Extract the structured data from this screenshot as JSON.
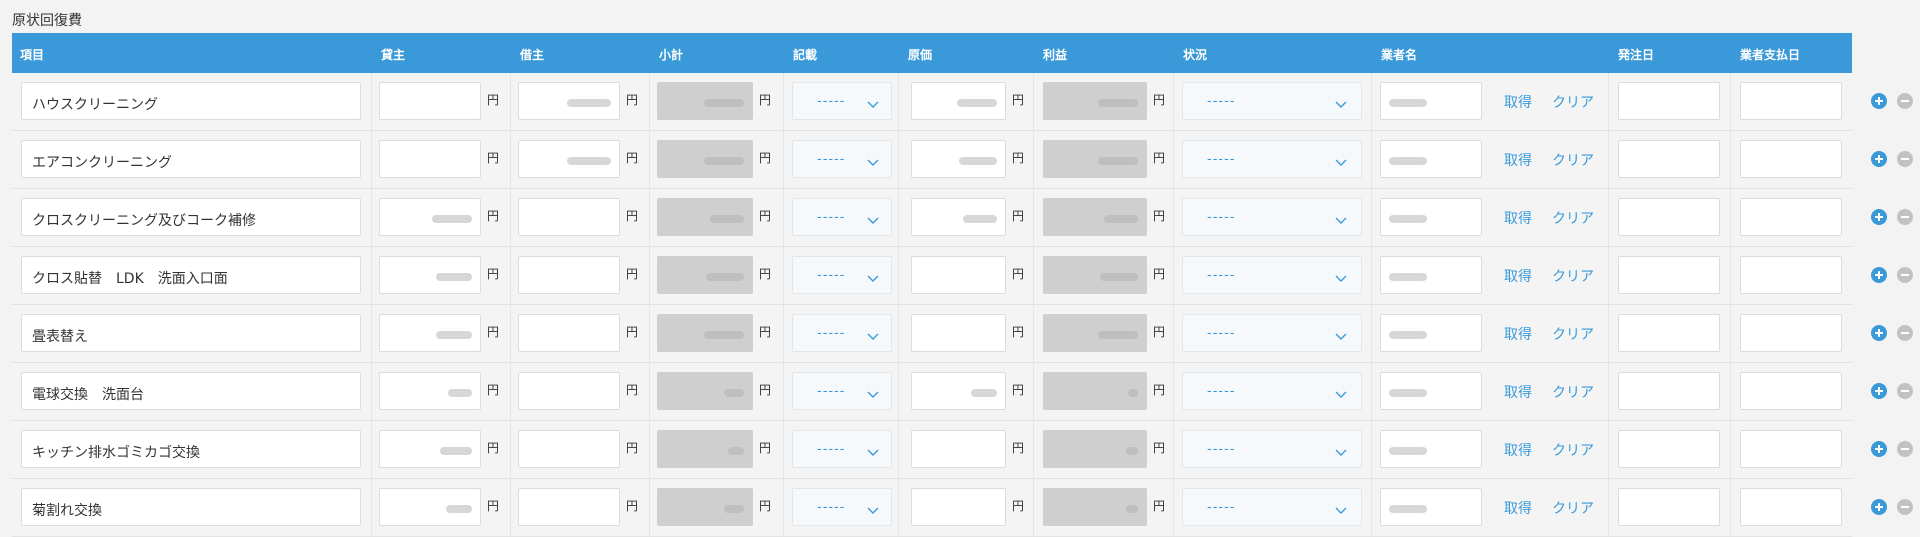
{
  "section_title": "原状回復費",
  "headers": {
    "item": "項目",
    "landlord": "貸主",
    "tenant": "借主",
    "subtotal": "小計",
    "entry": "記載",
    "cost": "原価",
    "profit": "利益",
    "status": "状況",
    "vendor": "業者名",
    "order_date": "発注日",
    "vendor_payment_date": "業者支払日"
  },
  "labels": {
    "yen": "円",
    "select_placeholder": "-----",
    "fetch": "取得",
    "clear": "クリア"
  },
  "rows": [
    {
      "item": "ハウスクリーニング"
    },
    {
      "item": "エアコンクリーニング"
    },
    {
      "item": "クロスクリーニング及びコーク補修"
    },
    {
      "item": "クロス貼替　LDK　洗面入口面"
    },
    {
      "item": "畳表替え"
    },
    {
      "item": "電球交換　洗面台"
    },
    {
      "item": "キッチン排水ゴミカゴ交換"
    },
    {
      "item": "菊割れ交換"
    }
  ],
  "colors": {
    "header_bg": "#3a9ad9",
    "accent": "#3a9ad9",
    "readonly_bg": "#cfcfcf"
  }
}
